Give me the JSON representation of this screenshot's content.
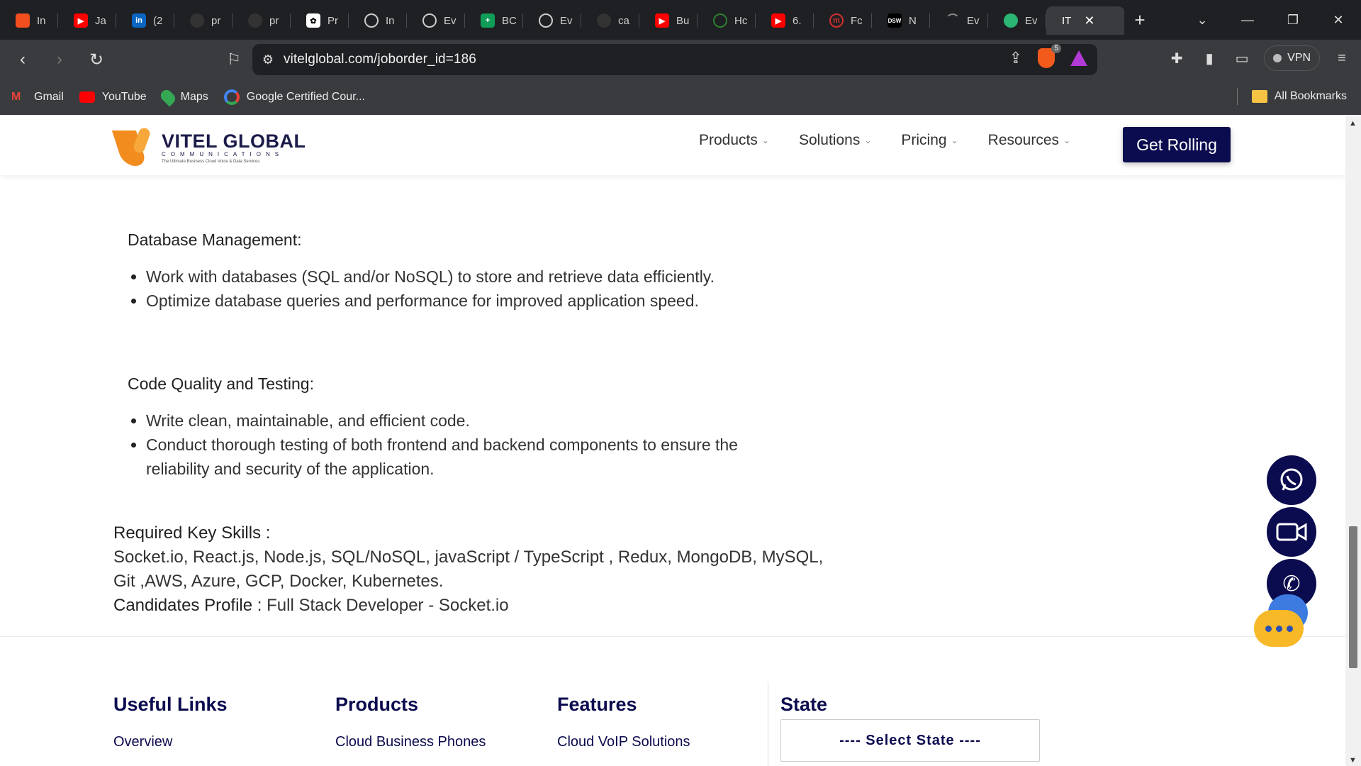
{
  "browser": {
    "tabs": [
      {
        "label": "In",
        "icon": "figma-icon",
        "color": "#f24e1e"
      },
      {
        "label": "Ja",
        "icon": "youtube-icon",
        "color": "#ff0000"
      },
      {
        "label": "(2",
        "icon": "linkedin-icon",
        "color": "#0a66c2"
      },
      {
        "label": "pr",
        "icon": "github-icon",
        "color": "#333333"
      },
      {
        "label": "pr",
        "icon": "github-icon",
        "color": "#333333"
      },
      {
        "label": "Pr",
        "icon": "chatgpt-icon",
        "color": "#ffffff"
      },
      {
        "label": "In",
        "icon": "globe-icon",
        "color": "#888888"
      },
      {
        "label": "Ev",
        "icon": "edge-icon",
        "color": "#888888"
      },
      {
        "label": "BC",
        "icon": "sheets-icon",
        "color": "#0f9d58"
      },
      {
        "label": "Ev",
        "icon": "edge-icon",
        "color": "#888888"
      },
      {
        "label": "ca",
        "icon": "github-icon",
        "color": "#333333"
      },
      {
        "label": "Bu",
        "icon": "youtube-icon",
        "color": "#ff0000"
      },
      {
        "label": "Hc",
        "icon": "hc-icon",
        "color": "#2e7d32"
      },
      {
        "label": "6.",
        "icon": "youtube-icon",
        "color": "#ff0000"
      },
      {
        "label": "Fc",
        "icon": "m-icon",
        "color": "#d32f2f"
      },
      {
        "label": "N",
        "icon": "dsw-icon",
        "color": "#000000"
      },
      {
        "label": "Ev",
        "icon": "loading-icon",
        "color": "#888888"
      },
      {
        "label": "Ev",
        "icon": "edge-icon",
        "color": "#2bb673"
      }
    ],
    "active_tab": {
      "label": "IT",
      "close": "✕"
    },
    "new_tab": "+",
    "url": "vitelglobal.com/joborder_id=186",
    "shield_badge": "5",
    "vpn_label": "VPN",
    "bookmarks": [
      {
        "label": "Gmail",
        "icon": "gmail-icon"
      },
      {
        "label": "YouTube",
        "icon": "youtube-icon"
      },
      {
        "label": "Maps",
        "icon": "maps-icon"
      },
      {
        "label": "Google Certified Cour...",
        "icon": "google-icon"
      }
    ],
    "all_bookmarks": "All Bookmarks"
  },
  "site": {
    "logo": {
      "name": "VITEL GLOBAL",
      "sub": "COMMUNICATIONS",
      "tag": "The Ultimate Business Cloud Voice & Data Services"
    },
    "nav": [
      {
        "label": "Products"
      },
      {
        "label": "Solutions"
      },
      {
        "label": "Pricing"
      },
      {
        "label": "Resources"
      }
    ],
    "cta": "Get Rolling"
  },
  "job": {
    "db_heading": "Database Management:",
    "db_points": [
      "Work with databases (SQL and/or NoSQL) to store and retrieve data efficiently.",
      "Optimize database queries and performance for improved application speed."
    ],
    "quality_heading": "Code Quality and Testing:",
    "quality_points": [
      "Write clean, maintainable, and efficient code.",
      "Conduct thorough testing of both frontend and backend components to ensure the reliability and security of the application."
    ],
    "skills_label": "Required Key Skills :",
    "skills_text": "Socket.io, React.js, Node.js, SQL/NoSQL, javaScript / TypeScript , Redux, MongoDB, MySQL, Git ,AWS, Azure, GCP, Docker, Kubernetes.",
    "profile_label": "Candidates Profile :",
    "profile_value": " Full Stack Developer - Socket.io"
  },
  "footer": {
    "useful_links": {
      "heading": "Useful Links",
      "first": "Overview"
    },
    "products": {
      "heading": "Products",
      "first": "Cloud Business Phones"
    },
    "features": {
      "heading": "Features",
      "first": "Cloud VoIP Solutions"
    },
    "state": {
      "heading": "State",
      "select": "---- Select State ----"
    }
  },
  "colors": {
    "brand_navy": "#0b0b4f",
    "brand_orange": "#f28c1f"
  }
}
